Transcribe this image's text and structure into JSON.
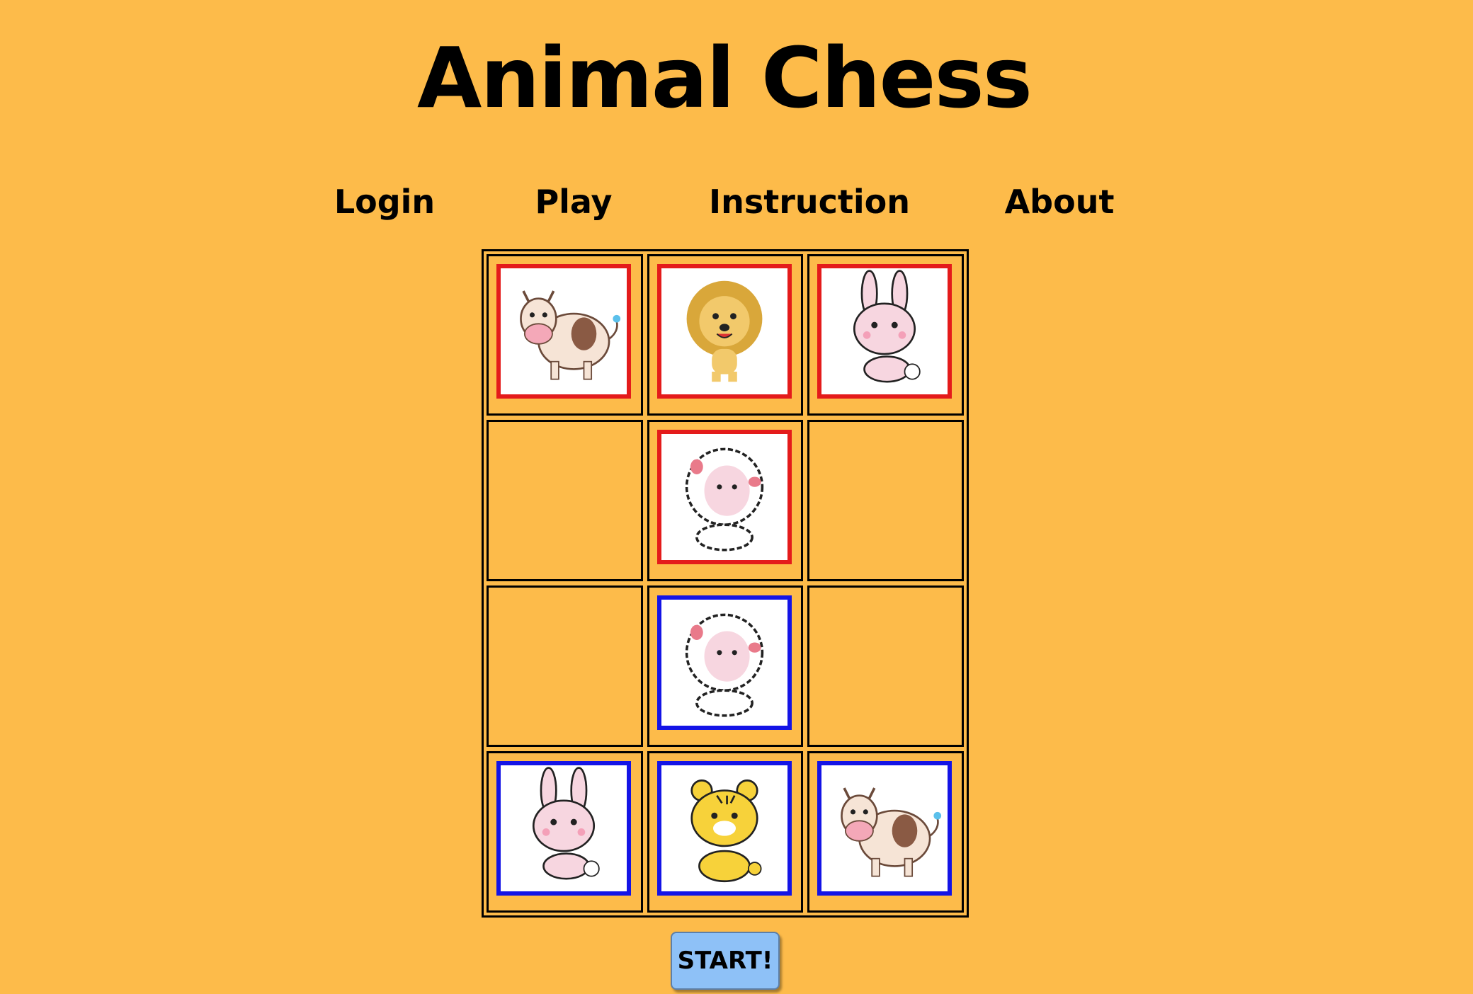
{
  "header": {
    "title": "Animal Chess"
  },
  "nav": {
    "items": [
      {
        "label": "Login",
        "name": "nav-login"
      },
      {
        "label": "Play",
        "name": "nav-play"
      },
      {
        "label": "Instruction",
        "name": "nav-instruction"
      },
      {
        "label": "About",
        "name": "nav-about"
      }
    ]
  },
  "board": {
    "rows": 4,
    "cols": 3,
    "cells": [
      [
        {
          "animal": "cow",
          "team": "red"
        },
        {
          "animal": "lion",
          "team": "red"
        },
        {
          "animal": "rabbit",
          "team": "red"
        }
      ],
      [
        null,
        {
          "animal": "sheep",
          "team": "red"
        },
        null
      ],
      [
        null,
        {
          "animal": "sheep",
          "team": "blue"
        },
        null
      ],
      [
        {
          "animal": "rabbit",
          "team": "blue"
        },
        {
          "animal": "tiger",
          "team": "blue"
        },
        {
          "animal": "cow",
          "team": "blue"
        }
      ]
    ],
    "colors": {
      "background": "#FDBB4A",
      "red_team": "#E41B1B",
      "blue_team": "#1414E6",
      "start_button": "#8EC1F7"
    }
  },
  "actions": {
    "start_label": "START!"
  }
}
